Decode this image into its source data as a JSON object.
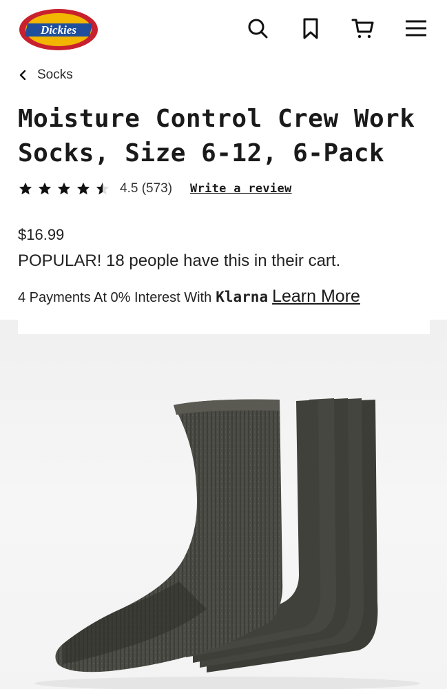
{
  "header": {
    "logo_text": "Dickies",
    "icons": [
      "search-icon",
      "bookmark-icon",
      "cart-icon",
      "menu-icon"
    ]
  },
  "breadcrumb": {
    "label": "Socks"
  },
  "product": {
    "title": "Moisture Control Crew Work Socks, Size 6-12, 6-Pack",
    "rating": 4.5,
    "rating_text": "4.5 (573)",
    "review_link": "Write a review",
    "price": "$16.99",
    "popular_text": "POPULAR! 18 people have this in their cart.",
    "klarna_prefix": "4 Payments At 0% Interest With",
    "klarna_brand": "Klarna",
    "learn_more": "Learn More"
  },
  "colors": {
    "logo_red": "#c8202f",
    "logo_yellow": "#f2b600",
    "logo_blue": "#1f4f9c",
    "sock": "#4a4a44"
  }
}
